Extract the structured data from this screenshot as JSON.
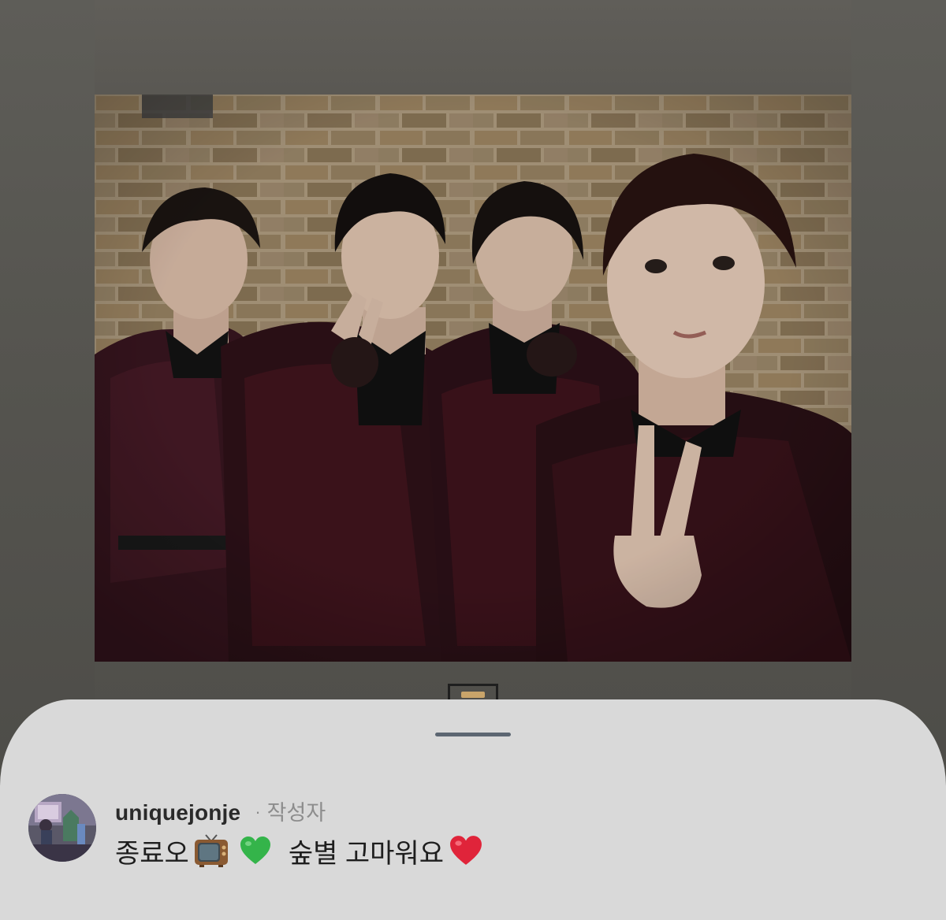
{
  "comment": {
    "username": "uniquejonje",
    "separator": "·",
    "author_tag": "작성자",
    "text_part1": "종료오",
    "text_part2": "숲별 고마워요",
    "emojis": [
      "television-icon",
      "green-heart-icon",
      "red-heart-icon"
    ]
  },
  "colors": {
    "sheet_bg": "#d9d9d9",
    "handle": "#5c6672",
    "green_heart": "#34b44a",
    "red_heart": "#e0243a"
  }
}
